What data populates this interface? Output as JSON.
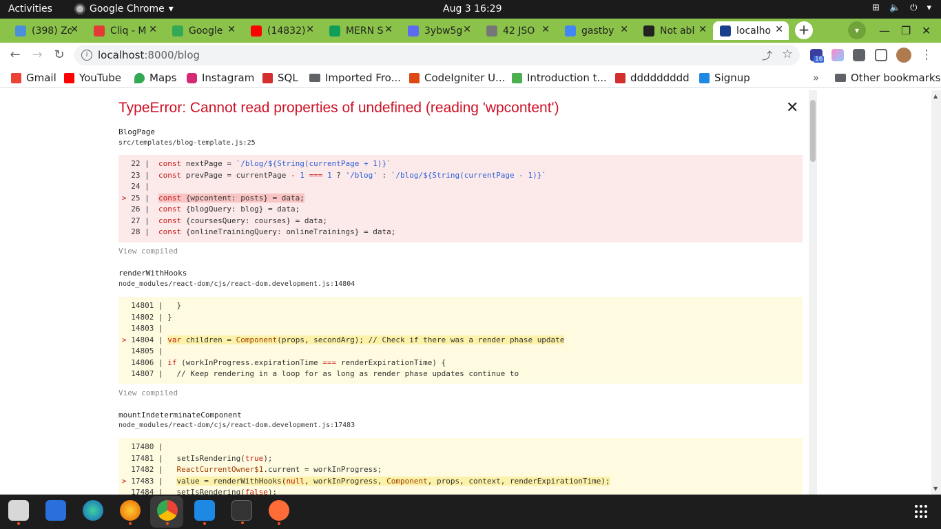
{
  "topbar": {
    "activities": "Activities",
    "app_name": "Google Chrome",
    "clock": "Aug 3  16:29"
  },
  "tabs": [
    {
      "title": "(398) Zo",
      "color": "#4a90d9"
    },
    {
      "title": "Cliq - M",
      "color": "#e53935"
    },
    {
      "title": "Google",
      "color": "#34a853"
    },
    {
      "title": "(14832)",
      "color": "#ff0000"
    },
    {
      "title": "MERN S",
      "color": "#0f9d58"
    },
    {
      "title": "3ybw5g",
      "color": "#5b6cf0"
    },
    {
      "title": "42 JSO",
      "color": "#777777"
    },
    {
      "title": "gastby",
      "color": "#4285f4"
    },
    {
      "title": "Not abl",
      "color": "#222222"
    },
    {
      "title": "localho",
      "color": "#1a3e8c"
    }
  ],
  "toolbar": {
    "url_host": "localhost",
    "url_path": ":8000/blog"
  },
  "bookmarks": {
    "items": [
      {
        "label": "Gmail",
        "color": "#ea4335"
      },
      {
        "label": "YouTube",
        "color": "#ff0000"
      },
      {
        "label": "Maps",
        "color": "#34a853"
      },
      {
        "label": "Instagram",
        "color": "#d62976"
      },
      {
        "label": "SQL",
        "color": "#d32f2f"
      },
      {
        "label": "Imported Fro...",
        "color": "#5f6368"
      },
      {
        "label": "CodeIgniter U...",
        "color": "#dd4814"
      },
      {
        "label": "Introduction t...",
        "color": "#4caf50"
      },
      {
        "label": "ddddddddd",
        "color": "#d32f2f"
      },
      {
        "label": "Signup",
        "color": "#1e88e5"
      }
    ],
    "overflow": "»",
    "other": "Other bookmarks"
  },
  "error": {
    "title": "TypeError: Cannot read properties of undefined (reading 'wpcontent')",
    "frames": [
      {
        "function": "BlogPage",
        "file": "src/templates/blog-template.js:25",
        "view_compiled": "View compiled"
      },
      {
        "function": "renderWithHooks",
        "file": "node_modules/react-dom/cjs/react-dom.development.js:14804",
        "view_compiled": "View compiled"
      },
      {
        "function": "mountIndeterminateComponent",
        "file": "node_modules/react-dom/cjs/react-dom.development.js:17483"
      }
    ]
  }
}
